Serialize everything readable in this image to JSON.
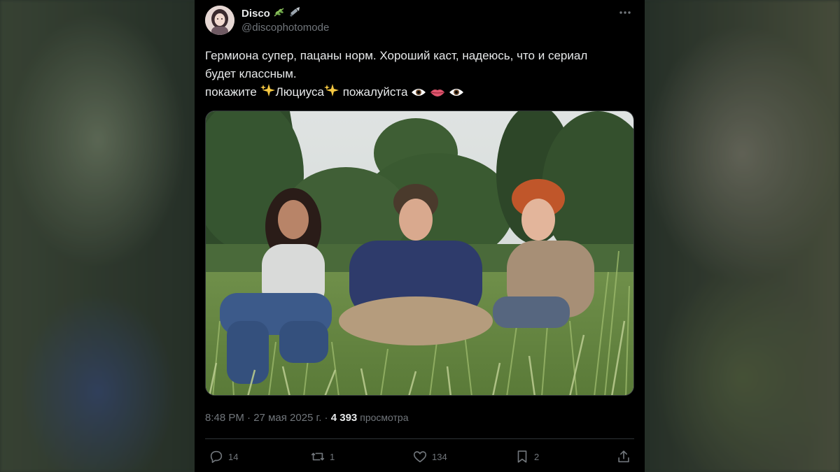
{
  "tweet": {
    "display_name": "Disco",
    "name_emojis": [
      "herb-emoji",
      "flashlight-emoji"
    ],
    "handle": "@discophotomode",
    "text_lines": [
      "Гермиона супер, пацаны норм. Хороший каст, надеюсь, что и сериал",
      "будет классным."
    ],
    "line3": {
      "before": "покажите ",
      "name": "Люциуса",
      "after": " пожалуйста "
    },
    "time": "8:48 PM",
    "separator": " · ",
    "date": "27 мая 2025 г.",
    "views_count": "4 393",
    "views_label": "просмотра"
  },
  "media": {
    "alt": "three smiling children sitting in tall grass in front of trees"
  },
  "actions": {
    "replies": "14",
    "retweets": "1",
    "likes": "134",
    "bookmarks": "2"
  },
  "colors": {
    "background": "#000000",
    "text": "#e7e9ea",
    "secondary": "#71767b",
    "border": "#2f3336"
  }
}
